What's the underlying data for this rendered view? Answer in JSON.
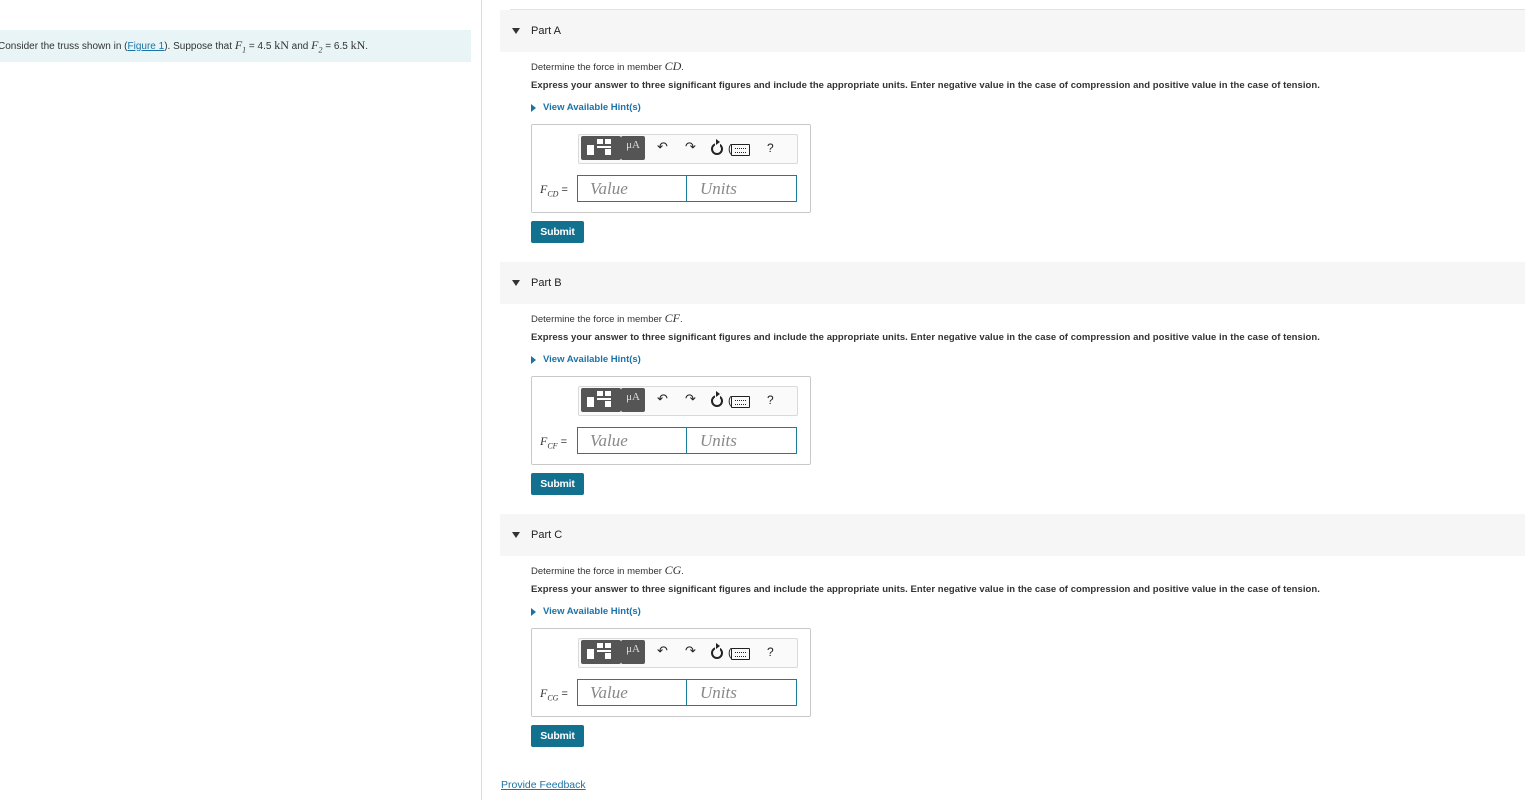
{
  "problem": {
    "prefix": "Consider the truss shown in (",
    "figure_link": "Figure 1",
    "middle": "). Suppose that ",
    "f1_symbol": "F",
    "f1_sub": "1",
    "f1_value": " = 4.5 ",
    "f1_unit": "kN",
    "and": " and ",
    "f2_symbol": "F",
    "f2_sub": "2",
    "f2_value": " = 6.5 ",
    "f2_unit": "kN",
    "end": "."
  },
  "parts": [
    {
      "title": "Part A",
      "question_prefix": "Determine the force in member ",
      "member": "CD",
      "question_end": ".",
      "instructions": "Express your answer to three significant figures and include the appropriate units. Enter negative value in the case of compression and positive value in the case of tension.",
      "hint": "View Available Hint(s)",
      "var_symbol": "F",
      "var_sub": "CD",
      "equals": " =",
      "value_placeholder": "Value",
      "units_placeholder": "Units",
      "submit": "Submit"
    },
    {
      "title": "Part B",
      "question_prefix": "Determine the force in member ",
      "member": "CF",
      "question_end": ".",
      "instructions": "Express your answer to three significant figures and include the appropriate units. Enter negative value in the case of compression and positive value in the case of tension.",
      "hint": "View Available Hint(s)",
      "var_symbol": "F",
      "var_sub": "CF",
      "equals": " =",
      "value_placeholder": "Value",
      "units_placeholder": "Units",
      "submit": "Submit"
    },
    {
      "title": "Part C",
      "question_prefix": "Determine the force in member ",
      "member": "CG",
      "question_end": ".",
      "instructions": "Express your answer to three significant figures and include the appropriate units. Enter negative value in the case of compression and positive value in the case of tension.",
      "hint": "View Available Hint(s)",
      "var_symbol": "F",
      "var_sub": "CG",
      "equals": " =",
      "value_placeholder": "Value",
      "units_placeholder": "Units",
      "submit": "Submit"
    }
  ],
  "toolbar": {
    "mu_label": "μA",
    "undo_icon": "undo-icon",
    "redo_icon": "redo-icon",
    "help_label": "?"
  },
  "feedback_link": "Provide Feedback",
  "colors": {
    "accent": "#12718f",
    "link": "#1a73a8",
    "problem_bg": "#e8f4f5",
    "header_bg": "#f6f6f6"
  }
}
